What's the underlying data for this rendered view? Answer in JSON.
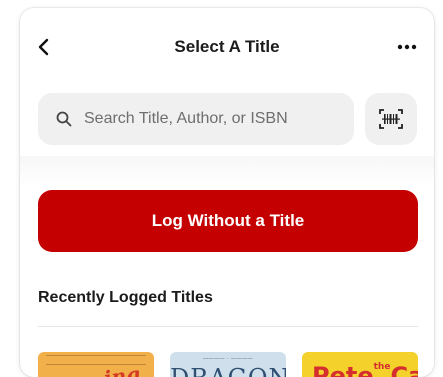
{
  "header": {
    "title": "Select A Title",
    "back_icon": "chevron-left-icon",
    "more_icon": "more-horizontal-icon"
  },
  "search": {
    "placeholder": "Search Title, Author, or ISBN",
    "value": "",
    "icon": "search-icon",
    "scan_icon": "barcode-scan-icon"
  },
  "actions": {
    "log_without_title": "Log Without a Title",
    "accent_color": "#c40000"
  },
  "recent": {
    "heading": "Recently Logged Titles",
    "books": [
      {
        "cover_text": ""
      },
      {
        "cover_text": "DRAGONS"
      },
      {
        "cover_text_main": "Pete",
        "cover_text_small": "the",
        "cover_text_end": "Cat"
      }
    ]
  }
}
